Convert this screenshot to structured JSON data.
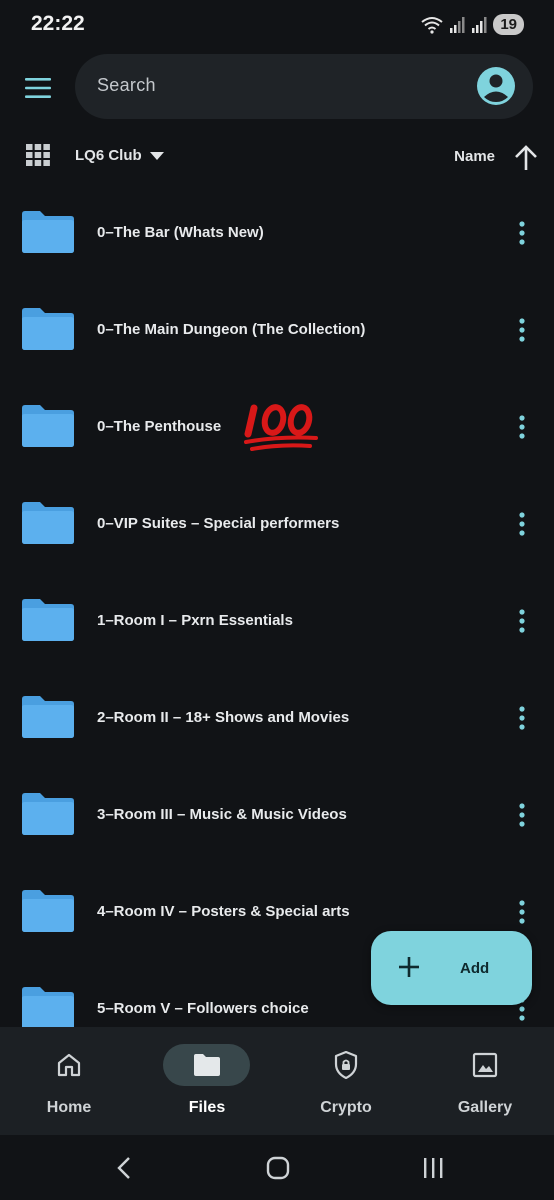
{
  "status_bar": {
    "time": "22:22",
    "battery": "19"
  },
  "header": {
    "menu_icon": "menu-icon",
    "search_placeholder": "Search",
    "account_icon": "account-circle-icon"
  },
  "toolbar": {
    "location": "LQ6 Club",
    "sort_label": "Name",
    "sort_direction_icon": "arrow-up-icon"
  },
  "folders": [
    {
      "name": "0–The Bar (Whats New)"
    },
    {
      "name": "0–The Main Dungeon (The Collection)"
    },
    {
      "name": "0–The Penthouse",
      "emoji": "hundred-points-emoji"
    },
    {
      "name": "0–VIP Suites – Special performers"
    },
    {
      "name": "1–Room I – Pxrn Essentials"
    },
    {
      "name": "2–Room II – 18+ Shows and Movies"
    },
    {
      "name": "3–Room III – Music & Music Videos"
    },
    {
      "name": "4–Room IV – Posters & Special arts"
    },
    {
      "name": "5–Room V – Followers choice"
    }
  ],
  "fab": {
    "label": "Add"
  },
  "bottom_nav": {
    "items": [
      {
        "label": "Home",
        "icon": "home-icon"
      },
      {
        "label": "Files",
        "icon": "folder-icon",
        "active": true
      },
      {
        "label": "Crypto",
        "icon": "shield-lock-icon"
      },
      {
        "label": "Gallery",
        "icon": "image-icon"
      }
    ]
  },
  "colors": {
    "background": "#111316",
    "folder": "#5aa9e6",
    "accent": "#7fd3dd",
    "active_pill": "#38474b"
  }
}
